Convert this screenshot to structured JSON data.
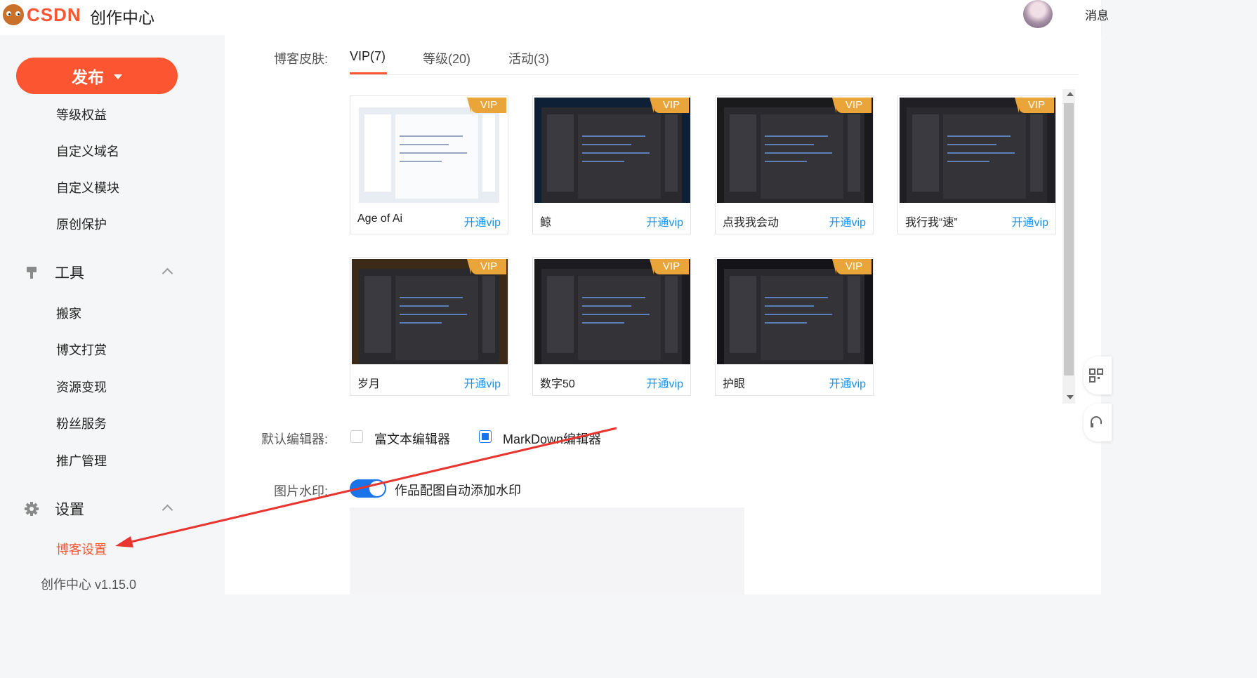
{
  "header": {
    "logo_text": "CSDN",
    "app_title": "创作中心",
    "message_text": "消息"
  },
  "sidebar": {
    "publish_label": "发布",
    "items_top": [
      "等级权益",
      "自定义域名",
      "自定义模块",
      "原创保护"
    ],
    "tools_title": "工具",
    "tools_items": [
      "搬家",
      "博文打赏",
      "资源变现",
      "粉丝服务",
      "推广管理"
    ],
    "settings_title": "设置",
    "settings_items": [
      "博客设置"
    ],
    "version": "创作中心 v1.15.0"
  },
  "skins": {
    "label": "博客皮肤:",
    "tabs": [
      "VIP(7)",
      "等级(20)",
      "活动(3)"
    ],
    "active_tab": "VIP(7)",
    "badge": "VIP",
    "cards": [
      {
        "name": "Age of Ai",
        "action": "开通vip"
      },
      {
        "name": "鲸",
        "action": "开通vip"
      },
      {
        "name": "点我我会动",
        "action": "开通vip"
      },
      {
        "name": "我行我“速”",
        "action": "开通vip"
      },
      {
        "name": "岁月",
        "action": "开通vip"
      },
      {
        "name": "数字50",
        "action": "开通vip"
      },
      {
        "name": "护眼",
        "action": "开通vip"
      }
    ]
  },
  "editor": {
    "label": "默认编辑器:",
    "options": [
      "富文本编辑器",
      "MarkDown编辑器"
    ],
    "selected": "MarkDown编辑器"
  },
  "watermark": {
    "label": "图片水印:",
    "toggle_text": "作品配图自动添加水印",
    "enabled": true
  },
  "colors": {
    "brand": "#fc5531",
    "link": "#1a93ec",
    "vip_badge": "#e9a53a",
    "toggle_on": "#1a73e8",
    "annotation_arrow": "#e8352f"
  }
}
